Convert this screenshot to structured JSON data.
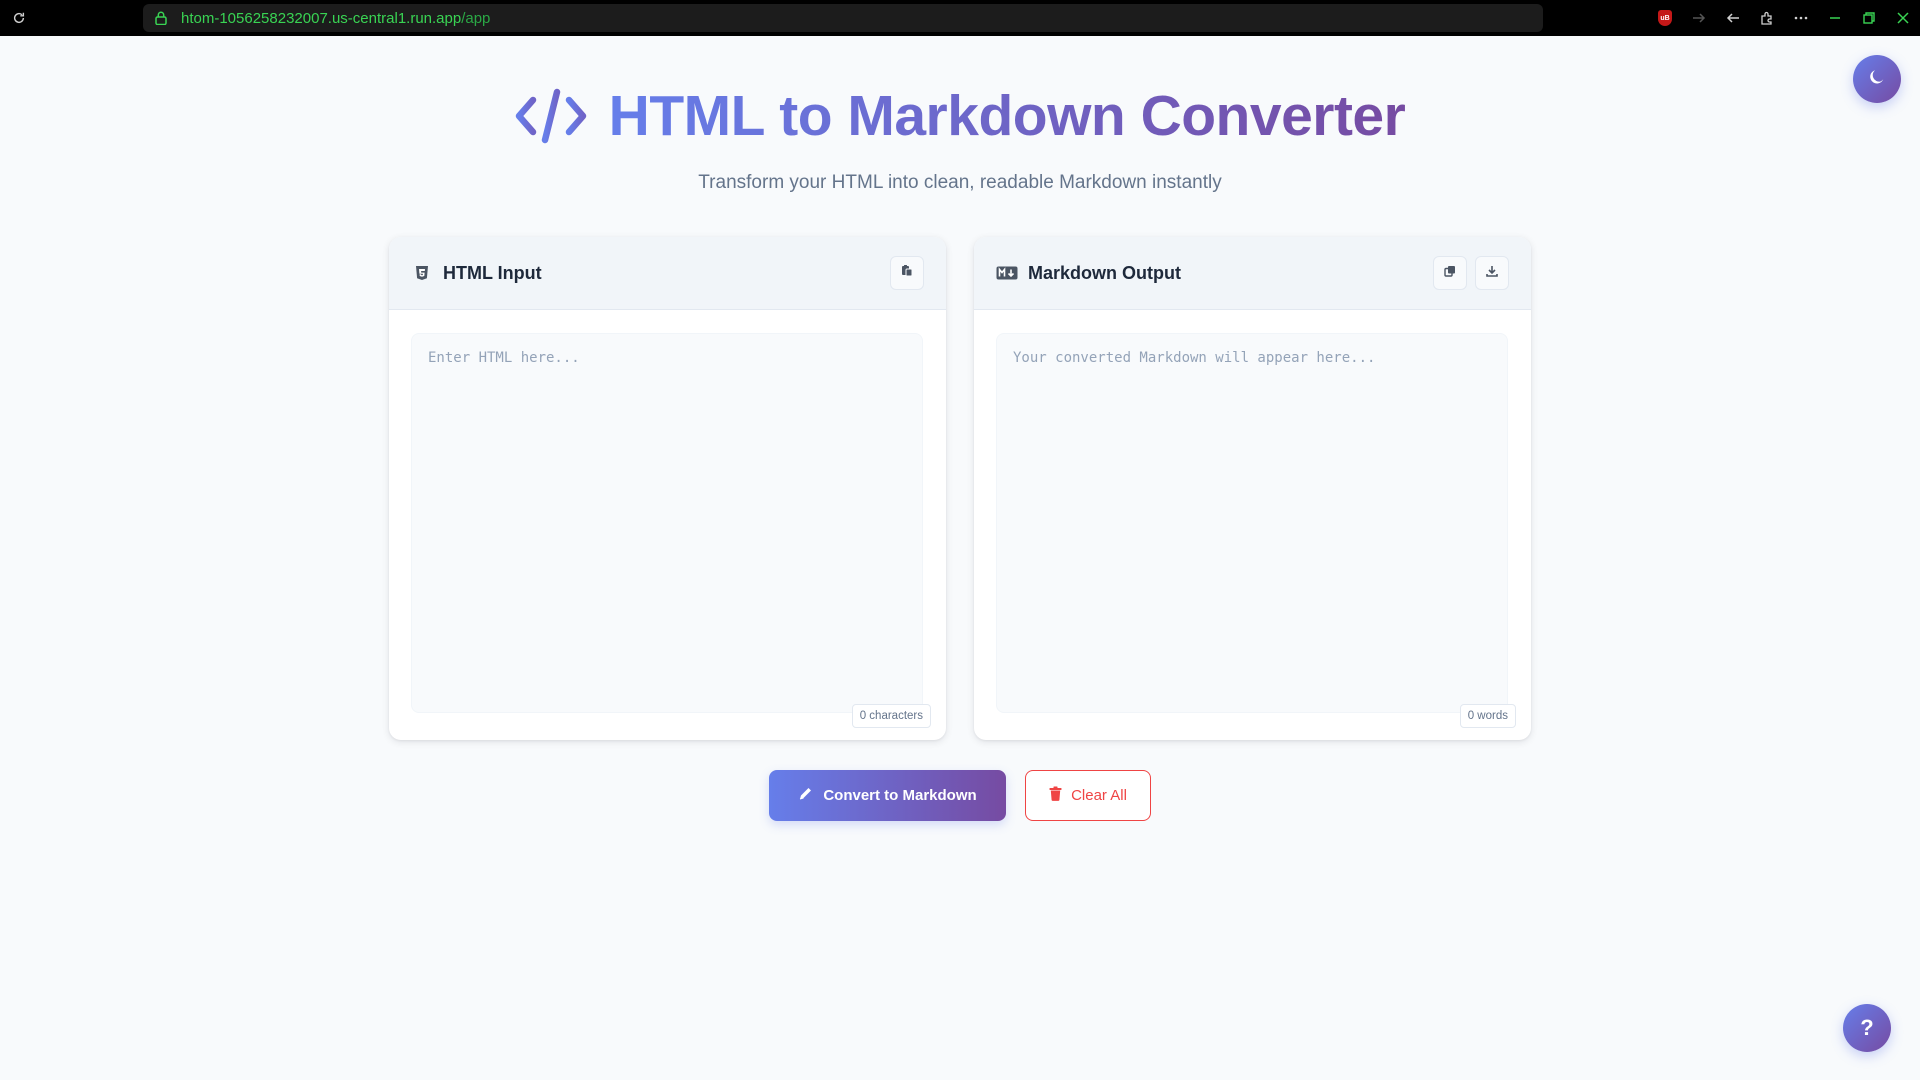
{
  "browser": {
    "url_host": "htom-1056258232007.us-central1.run.app",
    "url_path": "/app",
    "icons": [
      "reload-icon",
      "lock-icon",
      "ublock-icon",
      "forward-icon",
      "back-icon",
      "extensions-icon",
      "more-icon",
      "minimize-icon",
      "restore-icon",
      "close-icon"
    ]
  },
  "header": {
    "title": "HTML to Markdown Converter",
    "subtitle": "Transform your HTML into clean, readable Markdown instantly",
    "icon": "code-icon"
  },
  "input_panel": {
    "title": "HTML Input",
    "icon": "html5-icon",
    "placeholder": "Enter HTML here...",
    "counter": "0 characters",
    "actions": [
      "paste-icon"
    ]
  },
  "output_panel": {
    "title": "Markdown Output",
    "icon": "markdown-icon",
    "placeholder": "Your converted Markdown will appear here...",
    "counter": "0 words",
    "actions": [
      "copy-icon",
      "download-icon"
    ]
  },
  "actions": {
    "convert_label": "Convert to Markdown",
    "clear_label": "Clear All"
  },
  "help": {
    "label": "?"
  },
  "colors": {
    "gradient_start": "#667eea",
    "gradient_end": "#764ba2",
    "danger": "#ef4444",
    "url_green": "#39d353"
  }
}
